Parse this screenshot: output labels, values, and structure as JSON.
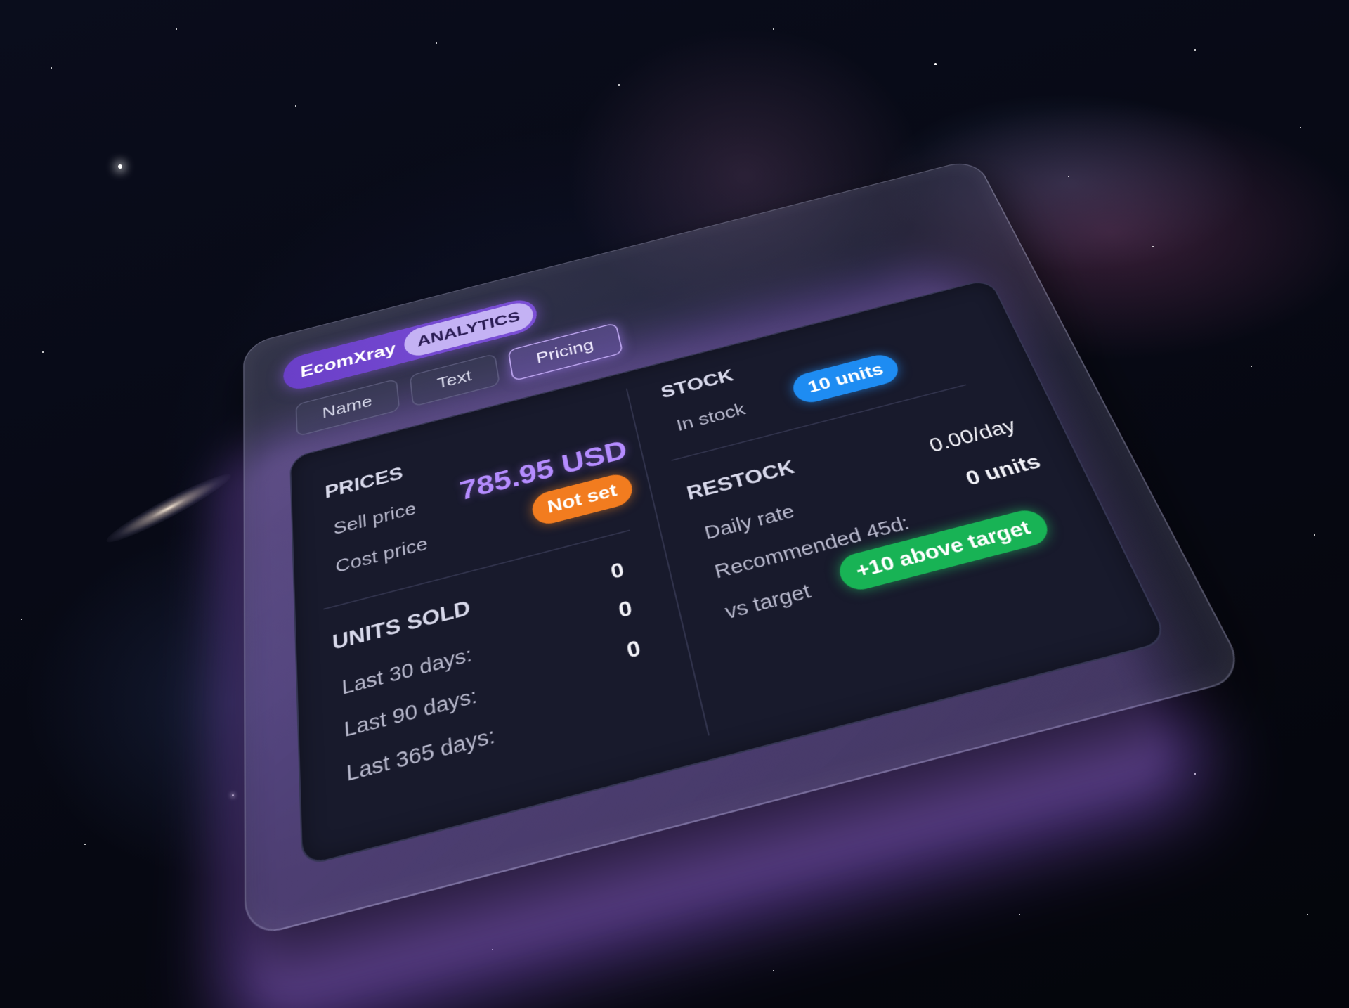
{
  "brand": {
    "name": "EcomXray",
    "tag": "ANALYTICS"
  },
  "tabs": [
    {
      "label": "Name",
      "active": false
    },
    {
      "label": "Text",
      "active": false
    },
    {
      "label": "Pricing",
      "active": true
    }
  ],
  "prices": {
    "title": "PRICES",
    "sell_label": "Sell price",
    "sell_value": "785.95 USD",
    "cost_label": "Cost price",
    "cost_value": "Not set"
  },
  "units_sold": {
    "title": "UNITS SOLD",
    "rows": [
      {
        "label": "Last 30 days:",
        "value": "0"
      },
      {
        "label": "Last 90 days:",
        "value": "0"
      },
      {
        "label": "Last 365 days:",
        "value": "0"
      }
    ]
  },
  "stock": {
    "title": "STOCK",
    "in_stock_label": "In stock",
    "in_stock_value": "10 units"
  },
  "restock": {
    "title": "RESTOCK",
    "daily_rate_label": "Daily rate",
    "daily_rate_value": "0.00/day",
    "recommended_label": "Recommended 45d:",
    "recommended_value": "0 units",
    "vs_target_label": "vs target",
    "vs_target_value": "+10 above target"
  },
  "colors": {
    "accent_purple": "#7b4fd6",
    "price": "#b58cff",
    "not_set": "#f27c1f",
    "in_stock": "#1e8cf2",
    "above_target": "#18b355"
  }
}
